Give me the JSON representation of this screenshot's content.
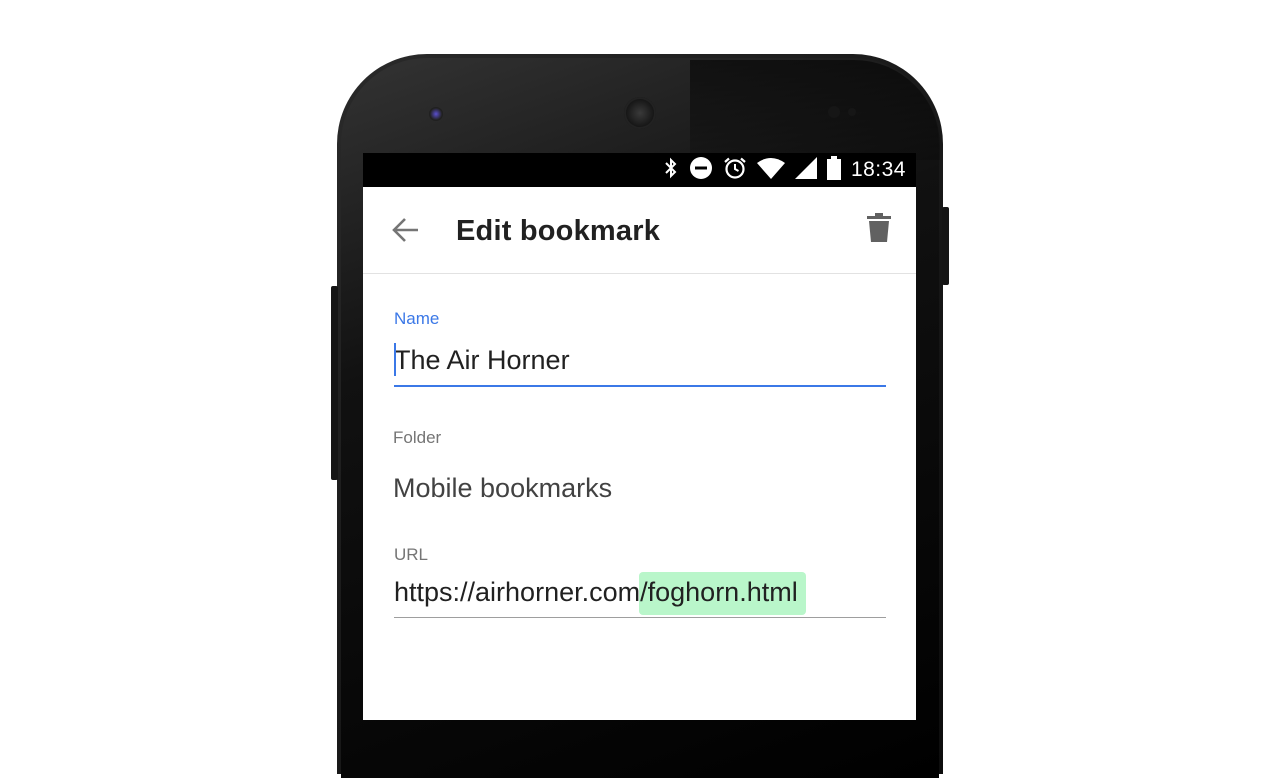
{
  "status_bar": {
    "time": "18:34",
    "icons": [
      "bluetooth-icon",
      "do-not-disturb-icon",
      "alarm-icon",
      "wifi-icon",
      "cell-signal-icon",
      "battery-icon"
    ]
  },
  "toolbar": {
    "title": "Edit bookmark",
    "back_icon": "arrow-back-icon",
    "delete_icon": "trash-icon"
  },
  "form": {
    "name_label": "Name",
    "name_value": "The Air Horner",
    "folder_label": "Folder",
    "folder_value": "Mobile bookmarks",
    "url_label": "URL",
    "url_prefix": "https://airhorner.com",
    "url_highlight": "/foghorn.html"
  },
  "colors": {
    "accent": "#3b78e7",
    "highlight": "#b9f6ca",
    "status_bar": "#000000"
  }
}
